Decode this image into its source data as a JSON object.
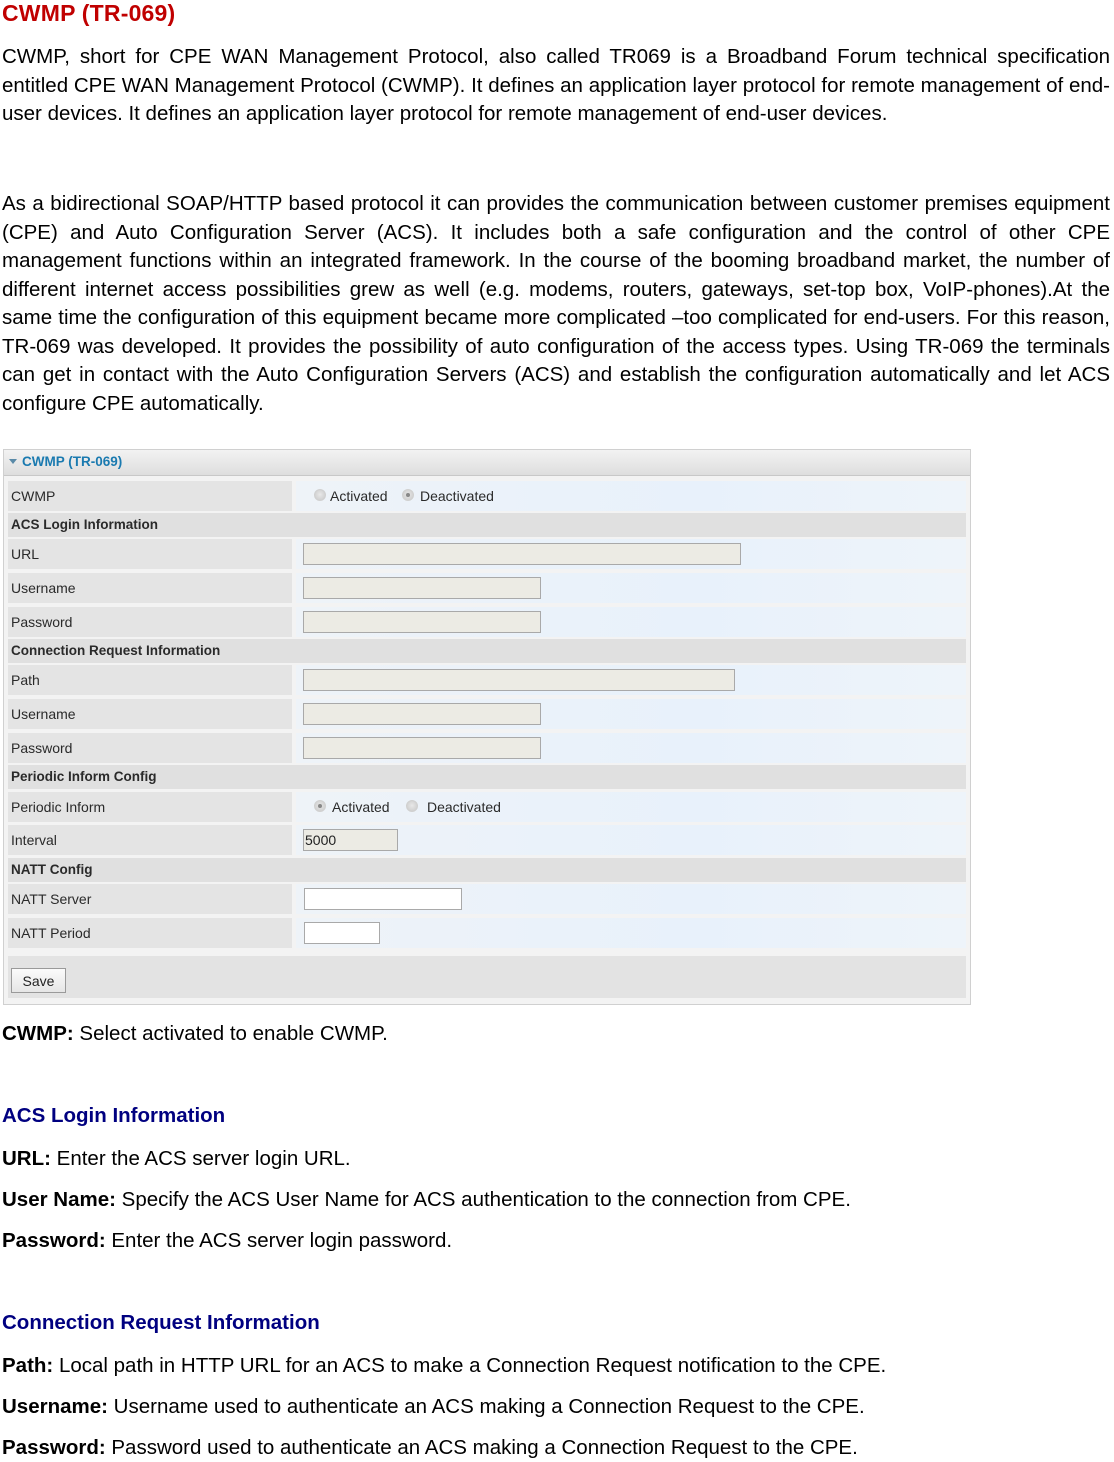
{
  "document": {
    "title": "CWMP (TR-069)",
    "paragraphs": [
      "CWMP, short for CPE WAN Management Protocol, also called TR069 is a Broadband Forum technical specification entitled CPE WAN Management Protocol (CWMP). It defines an application layer protocol for remote management of end-user devices. It defines an application layer protocol for remote management of end-user devices.",
      "As a bidirectional SOAP/HTTP based protocol it can provides the communication between customer premises equipment (CPE) and Auto Configuration Server (ACS). It includes both a safe configuration and the control of other CPE management functions within an integrated framework. In the course of the booming broadband market, the number of different internet access possibilities grew as well (e.g. modems, routers, gateways, set-top box, VoIP-phones).At the same time the configuration of this equipment became more complicated –too complicated for end-users. For this reason, TR-069 was developed. It provides the possibility of auto configuration of the access types. Using TR-069 the terminals can get in contact with the Auto Configuration Servers (ACS) and establish the configuration automatically and let ACS configure CPE automatically."
    ]
  },
  "panel": {
    "title": "CWMP (TR-069)",
    "icon": "caret-down-icon",
    "cwmp": {
      "label": "CWMP",
      "options": [
        "Activated",
        "Deactivated"
      ],
      "selected": "Deactivated"
    },
    "acs_section": "ACS Login Information",
    "acs_url_label": "URL",
    "acs_url_value": "",
    "acs_username_label": "Username",
    "acs_username_value": "",
    "acs_password_label": "Password",
    "acs_password_value": "",
    "conn_section": "Connection Request Information",
    "conn_path_label": "Path",
    "conn_path_value": "",
    "conn_username_label": "Username",
    "conn_username_value": "",
    "conn_password_label": "Password",
    "conn_password_value": "",
    "periodic_section": "Periodic Inform Config",
    "periodic": {
      "label": "Periodic Inform",
      "options": [
        "Activated",
        "Deactivated"
      ],
      "selected": "Activated"
    },
    "interval_label": "Interval",
    "interval_value": "5000",
    "natt_section": "NATT Config",
    "natt_server_label": "NATT Server",
    "natt_server_value": "",
    "natt_period_label": "NATT Period",
    "natt_period_value": "",
    "save_label": "Save"
  },
  "descriptions": {
    "cwmp": {
      "term": "CWMP:",
      "text": " Select activated to enable CWMP."
    },
    "acs_heading": "ACS Login Information",
    "acs_items": [
      {
        "term": "URL:",
        "text": " Enter the ACS server login URL."
      },
      {
        "term": "User Name:",
        "text": " Specify the ACS User Name for ACS authentication to the connection from CPE."
      },
      {
        "term": "Password:",
        "text": " Enter the ACS server login password."
      }
    ],
    "conn_heading": "Connection Request Information",
    "conn_items": [
      {
        "term": "Path:",
        "text": " Local path in HTTP URL for an ACS to make a Connection Request notification to the CPE."
      },
      {
        "term": "Username:",
        "text": " Username used to authenticate an ACS making a Connection Request to the CPE."
      },
      {
        "term": "Password:",
        "text": " Password used to authenticate an ACS making a Connection Request to the CPE."
      }
    ]
  }
}
